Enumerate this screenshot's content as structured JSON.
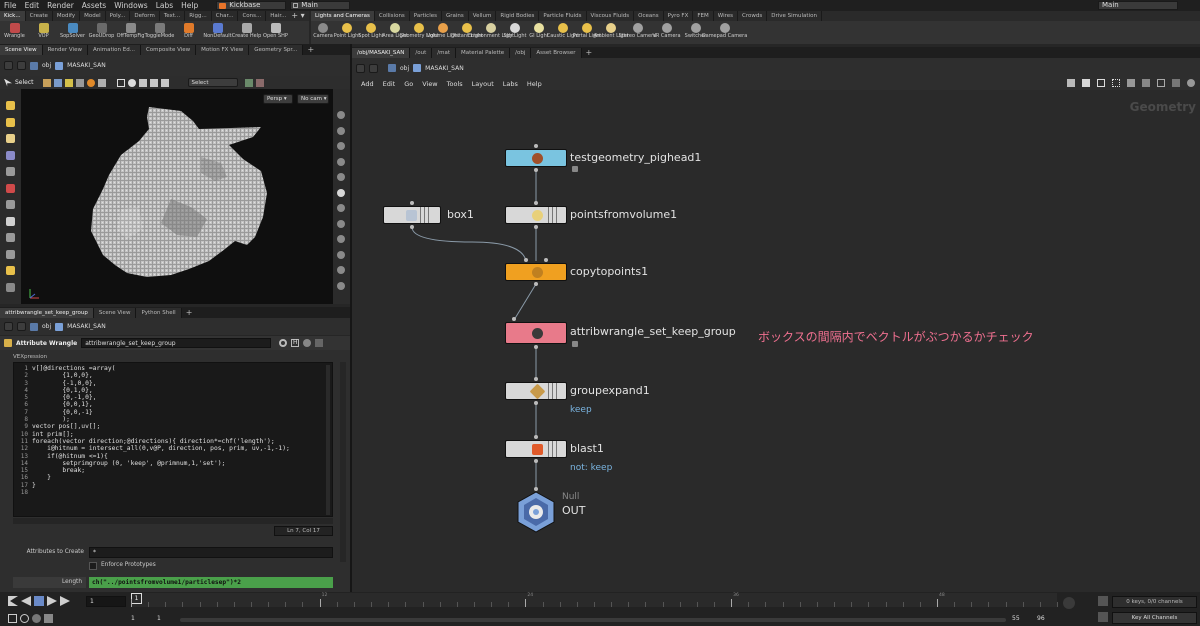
{
  "menubar": {
    "items": [
      "File",
      "Edit",
      "Render",
      "Assets",
      "Windows",
      "Labs",
      "Help"
    ],
    "build": "Kickbase",
    "desktop": "Main",
    "desktop_right": "Main"
  },
  "shelf_tabs_left": [
    "Kick...",
    "Create",
    "Modify",
    "Model",
    "Poly...",
    "Deform",
    "Text...",
    "Rigg...",
    "Char...",
    "Cons...",
    "Hair..."
  ],
  "shelf_tools_left": [
    {
      "label": "Wrangle",
      "color": "#c04a4a"
    },
    {
      "label": "VOP",
      "color": "#c8b24a"
    },
    {
      "label": "SopSolver",
      "color": "#4a8ac0"
    },
    {
      "label": "GeoUDrop",
      "color": "#6a6a6a"
    },
    {
      "label": "OffTempFig",
      "color": "#8a8a8a"
    },
    {
      "label": "ToggleMode",
      "color": "#7a7a7a"
    },
    {
      "label": "Diff",
      "color": "#e07a2a"
    },
    {
      "label": "NonDefault",
      "color": "#5a7ad0"
    },
    {
      "label": "Create Help",
      "color": "#aaaaaa"
    },
    {
      "label": "Open SHP",
      "color": "#bbbbbb"
    }
  ],
  "shelf_tabs_right": [
    "Lights and Cameras",
    "Collisions",
    "Particles",
    "Grains",
    "Vellum",
    "Rigid Bodies",
    "Particle Fluids",
    "Viscous Fluids",
    "Oceans",
    "Pyro FX",
    "FEM",
    "Wires",
    "Crowds",
    "Drive Simulation"
  ],
  "shelf_tools_right": [
    {
      "label": "Camera"
    },
    {
      "label": "Point Light"
    },
    {
      "label": "Spot Light"
    },
    {
      "label": "Area Light"
    },
    {
      "label": "Geometry Light"
    },
    {
      "label": "Volume Light"
    },
    {
      "label": "Distant Light"
    },
    {
      "label": "Environment Light"
    },
    {
      "label": "Sky Light"
    },
    {
      "label": "GI Light"
    },
    {
      "label": "Caustic Light"
    },
    {
      "label": "Portal Light"
    },
    {
      "label": "Ambient Light"
    },
    {
      "label": "Stereo Camera"
    },
    {
      "label": "VR Camera"
    },
    {
      "label": "Switcher"
    },
    {
      "label": "Gamepad Camera"
    }
  ],
  "left_pane_tabs": [
    "Scene View",
    "Render View",
    "Animation Ed...",
    "Composite View",
    "Motion FX View",
    "Geometry Spr..."
  ],
  "right_pane_tabs": [
    "/obj/MASAKI_SAN",
    "/out",
    "/mat",
    "Material Palette",
    "/obj",
    "Asset Browser"
  ],
  "viewport": {
    "path_root": "obj",
    "path_node": "MASAKI_SAN",
    "select_label": "Select",
    "select_mode": "Select",
    "persp": "Persp",
    "cam": "No cam"
  },
  "network": {
    "path_root": "obj",
    "path_node": "MASAKI_SAN",
    "menu": [
      "Add",
      "Edit",
      "Go",
      "View",
      "Tools",
      "Layout",
      "Labs",
      "Help"
    ],
    "context_label": "Geometry",
    "annotation": "ボックスの間隔内でベクトルがぶつかるかチェック",
    "nodes": [
      {
        "name": "testgeometry_pighead1",
        "color": "#7ac4e0",
        "icon": "#a0502a"
      },
      {
        "name": "box1",
        "color": "#d4d4d4",
        "icon": "#b8c4d4"
      },
      {
        "name": "pointsfromvolume1",
        "color": "#d4d4d4",
        "icon": "#e8d07a"
      },
      {
        "name": "copytopoints1",
        "color": "#f0a020",
        "icon": "#c08020"
      },
      {
        "name": "attribwrangle_set_keep_group",
        "color": "#e87a8a",
        "icon": "#3a3a3a"
      },
      {
        "name": "groupexpand1",
        "color": "#d4d4d4",
        "icon": "#c89a4a"
      },
      {
        "name": "blast1",
        "color": "#d4d4d4",
        "icon": "#e05a2a"
      },
      {
        "name": "OUT",
        "color": "#7aa0d8",
        "icon": "#ffffff"
      }
    ],
    "groupexpand_sub": "keep",
    "blast_sub": "not: keep",
    "out_type": "Null"
  },
  "param_tabs": [
    "attribwrangle_set_keep_group",
    "Scene View",
    "Python Shell"
  ],
  "params": {
    "path_root": "obj",
    "path_node": "MASAKI_SAN",
    "op_type": "Attribute Wrangle",
    "op_name": "attribwrangle_set_keep_group",
    "vex_label": "VEXpression",
    "code_lines": [
      "v[]@directions =array(",
      "        {1,0,0},",
      "        {-1,0,0},",
      "        {0,1,0},",
      "        {0,-1,0},",
      "        {0,0,1},",
      "        {0,0,-1}",
      "        );",
      "vector pos[],uv[];",
      "int prim[];",
      "foreach(vector direction;@directions){ direction*=chf('length');",
      "    i@hitnum = intersect_all(0,v@P, direction, pos, prim, uv,-1,-1);",
      "    if(@hitnum <=1){",
      "        setprimgroup (0, 'keep', @primnum,1,'set');",
      "        break;",
      "    }",
      "}",
      ""
    ],
    "cursor_pos": "Ln 7, Col 17",
    "attrs_label": "Attributes to Create",
    "attrs_value": "*",
    "enforce_label": "Enforce Prototypes",
    "length_label": "Length",
    "length_value": "ch(\"../pointsfromvolume1/particlesep\")*2"
  },
  "timeline": {
    "current_frame": "1",
    "range_start": "1",
    "range_start2": "1",
    "range_end": "55",
    "range_end2": "96",
    "ticks": [
      "1",
      "12",
      "24",
      "36",
      "48"
    ],
    "keys_label": "0 keys, 0/0 channels",
    "keys_button": "Key All Channels"
  }
}
